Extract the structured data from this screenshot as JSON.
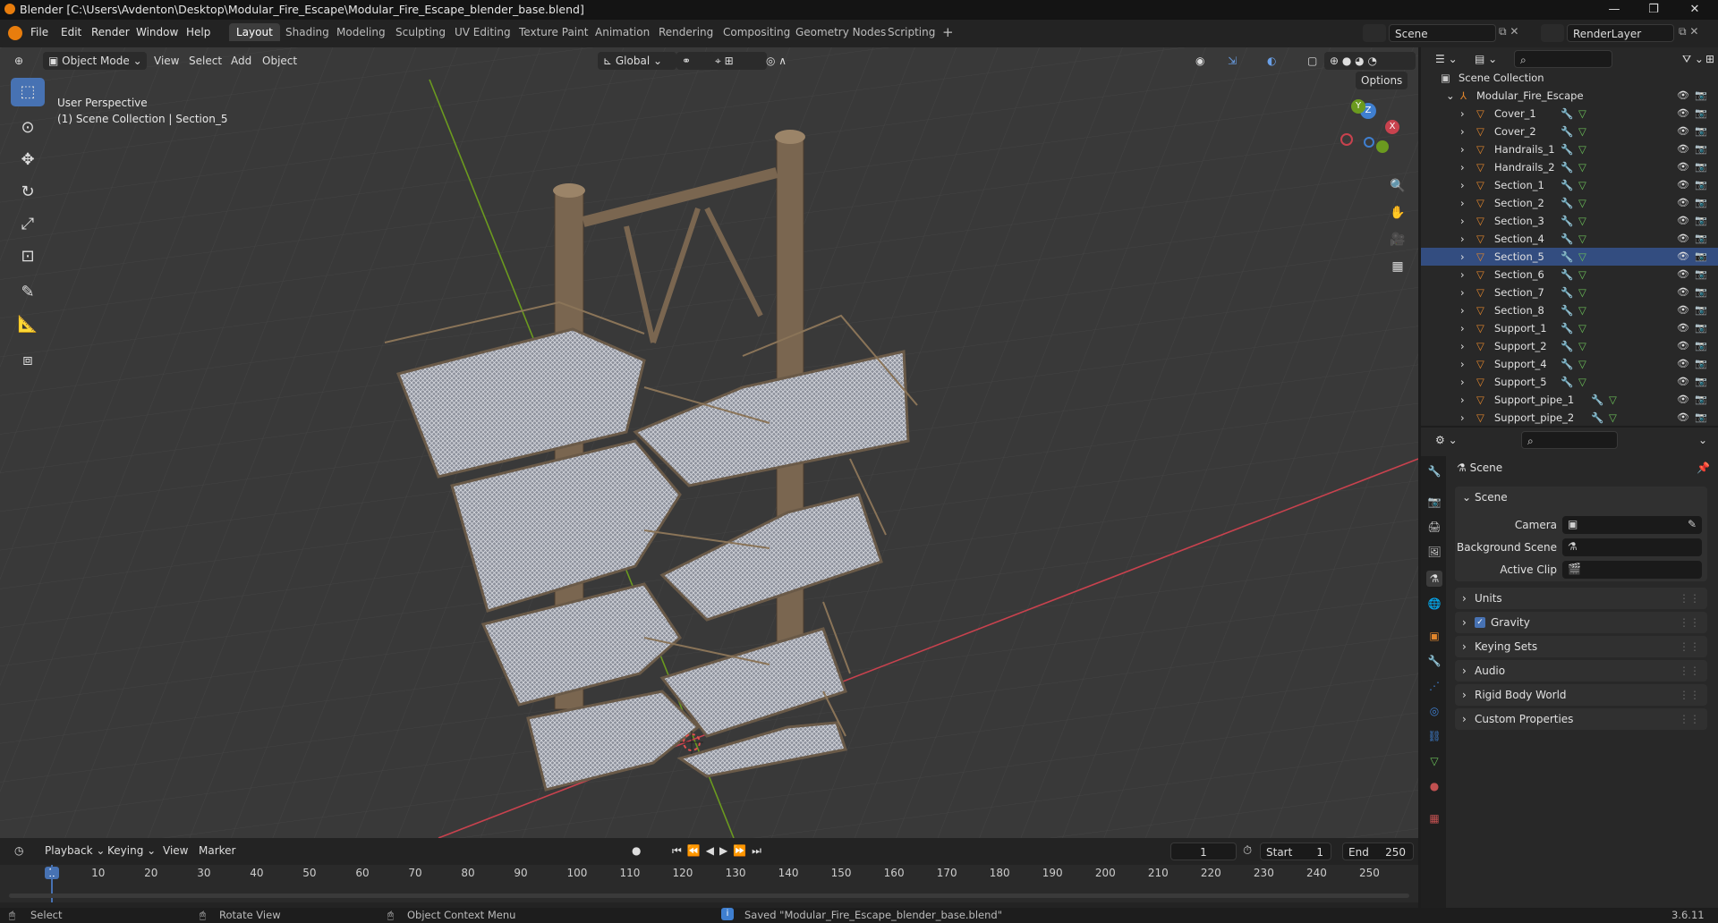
{
  "title_bar": {
    "title": "Blender [C:\\Users\\Avdenton\\Desktop\\Modular_Fire_Escape\\Modular_Fire_Escape_blender_base.blend]",
    "minimize": "—",
    "maximize": "❐",
    "close": "✕"
  },
  "menu": [
    "File",
    "Edit",
    "Render",
    "Window",
    "Help"
  ],
  "workspaces": [
    "Layout",
    "Shading",
    "Modeling",
    "Sculpting",
    "UV Editing",
    "Texture Paint",
    "Animation",
    "Rendering",
    "Compositing",
    "Geometry Nodes",
    "Scripting",
    "+"
  ],
  "scene": {
    "name": "Scene",
    "view_layer": "RenderLayer"
  },
  "viewport_header": {
    "mode": "Object Mode",
    "menus": [
      "View",
      "Select",
      "Add",
      "Object"
    ],
    "transform_orientation": "Global",
    "options": "Options"
  },
  "viewport": {
    "perspective": "User Perspective",
    "collection_info": "(1) Scene Collection | Section_5",
    "gizmo": {
      "x": "X",
      "y": "Y",
      "z": "Z"
    }
  },
  "timeline": {
    "menus": [
      "Playback",
      "Keying",
      "View",
      "Marker"
    ],
    "current_frame": "1",
    "start_label": "Start",
    "start": "1",
    "end_label": "End",
    "end": "250",
    "ruler": [
      "1",
      "10",
      "20",
      "30",
      "40",
      "50",
      "60",
      "70",
      "80",
      "90",
      "100",
      "110",
      "120",
      "130",
      "140",
      "150",
      "160",
      "170",
      "180",
      "190",
      "200",
      "210",
      "220",
      "230",
      "240",
      "250"
    ]
  },
  "outliner": {
    "root": "Scene Collection",
    "collection": "Modular_Fire_Escape",
    "selected": "Section_5",
    "items": [
      "Cover_1",
      "Cover_2",
      "Handrails_1",
      "Handrails_2",
      "Section_1",
      "Section_2",
      "Section_3",
      "Section_4",
      "Section_5",
      "Section_6",
      "Section_7",
      "Section_8",
      "Support_1",
      "Support_2",
      "Support_4",
      "Support_5",
      "Support_pipe_1",
      "Support_pipe_2"
    ]
  },
  "properties": {
    "context": "Scene",
    "panel_scene": "Scene",
    "fields": [
      {
        "label": "Camera"
      },
      {
        "label": "Background Scene"
      },
      {
        "label": "Active Clip"
      }
    ],
    "collapsed_panels": [
      "Units",
      "Gravity",
      "Keying Sets",
      "Audio",
      "Rigid Body World",
      "Custom Properties"
    ],
    "gravity_checked": true
  },
  "status_bar": {
    "select": "Select",
    "rotate": "Rotate View",
    "context_menu": "Object Context Menu",
    "message": "Saved \"Modular_Fire_Escape_blender_base.blend\"",
    "version": "3.6.11"
  },
  "colors": {
    "accent": "#4772b3",
    "axis_x": "#c8424e",
    "axis_y": "#6b9a1f",
    "axis_z": "#3f7fd0",
    "object_orange": "#e2862c"
  }
}
